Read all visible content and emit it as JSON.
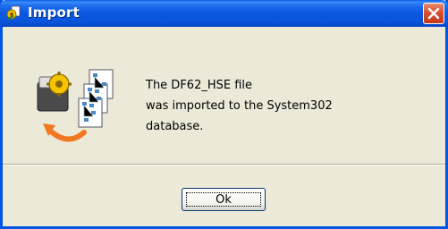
{
  "window": {
    "title": "Import",
    "icons": {
      "title": "import-title-icon",
      "close": "close-icon",
      "app": "import-files-icon"
    }
  },
  "message": {
    "lines": [
      "The DF62_HSE file",
      "was imported to the System302",
      "database."
    ]
  },
  "buttons": {
    "ok_label": "Ok"
  },
  "colors": {
    "titlebar": "#0a55dc",
    "close": "#d9502e",
    "background": "#ece9d8"
  }
}
